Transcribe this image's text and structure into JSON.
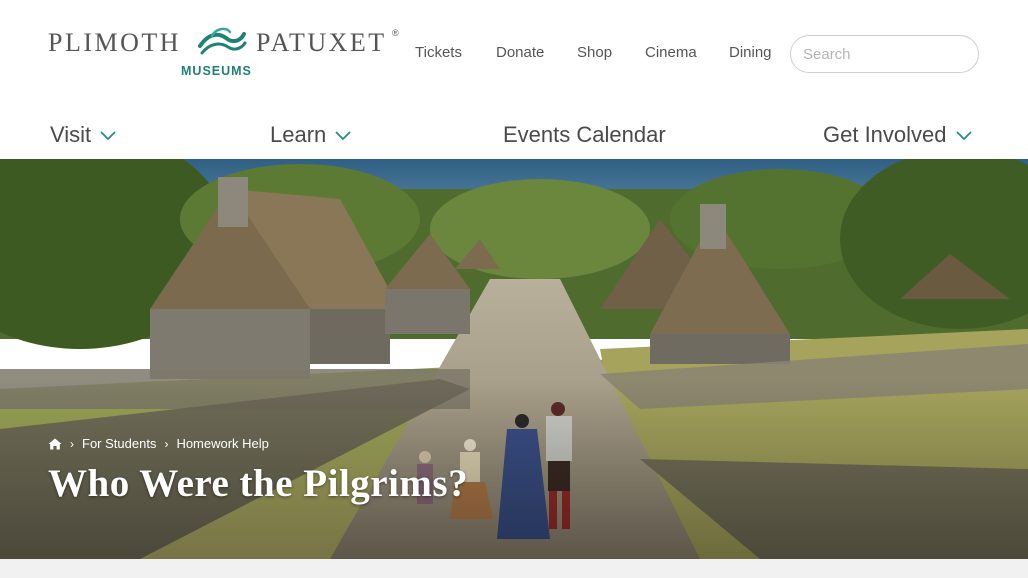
{
  "logo": {
    "left_text": "PLIMOTH",
    "right_text": "PATUXET",
    "registered": "®",
    "subtitle": "MUSEUMS",
    "accent_color": "#1f8076"
  },
  "utility_nav": [
    "Tickets",
    "Donate",
    "Shop",
    "Cinema",
    "Dining"
  ],
  "search": {
    "placeholder": "Search",
    "value": ""
  },
  "main_nav": [
    {
      "label": "Visit",
      "has_dropdown": true
    },
    {
      "label": "Learn",
      "has_dropdown": true
    },
    {
      "label": "Events Calendar",
      "has_dropdown": false
    },
    {
      "label": "Get Involved",
      "has_dropdown": true
    }
  ],
  "breadcrumb": {
    "home_icon": "home-icon",
    "items": [
      "For Students",
      "Homework Help"
    ]
  },
  "hero": {
    "title": "Who Were the Pilgrims?"
  },
  "colors": {
    "brand_teal": "#1f8076",
    "chevron_teal": "#2c8c83",
    "nav_text": "#4a4a4a"
  }
}
